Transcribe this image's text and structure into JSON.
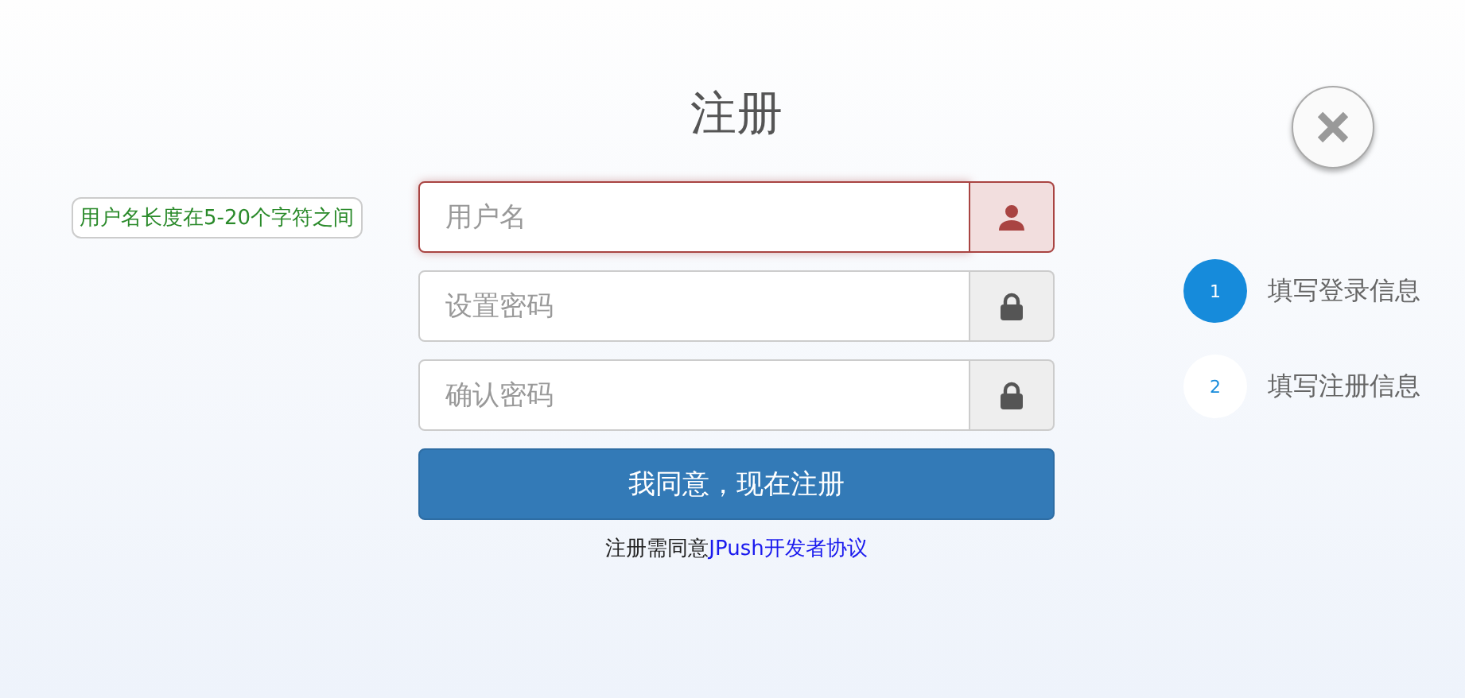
{
  "title": "注册",
  "hint": "用户名长度在5-20个字符之间",
  "fields": [
    {
      "placeholder": "用户名",
      "kind": "user",
      "error": true
    },
    {
      "placeholder": "设置密码",
      "kind": "lock",
      "error": false
    },
    {
      "placeholder": "确认密码",
      "kind": "lock",
      "error": false
    }
  ],
  "submit": "我同意，现在注册",
  "agreement": {
    "text": "注册需同意",
    "link": "JPush开发者协议"
  },
  "steps": [
    {
      "number": "1",
      "label": "填写登录信息",
      "selected": true
    },
    {
      "number": "2",
      "label": "填写注册信息",
      "selected": false
    }
  ]
}
